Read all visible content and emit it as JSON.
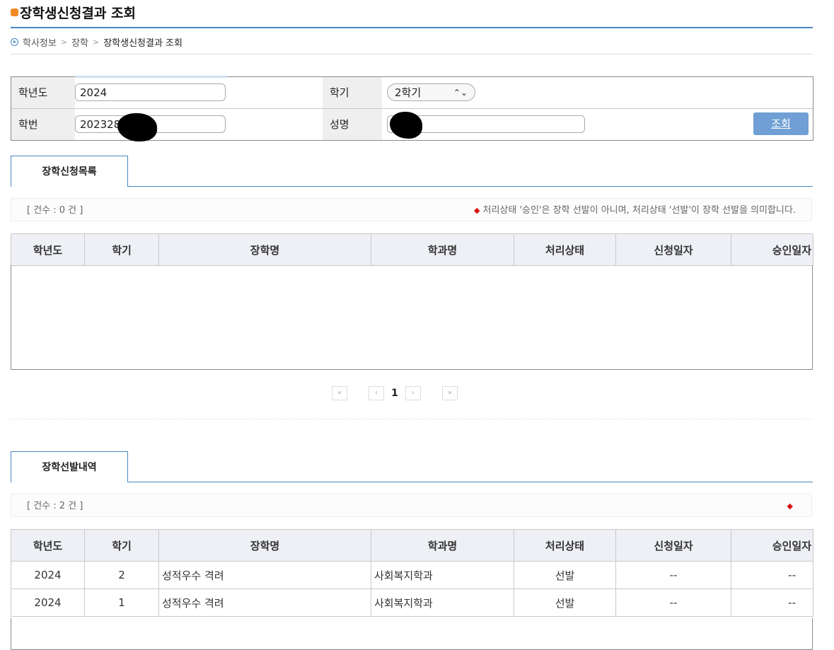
{
  "page": {
    "title": "장학생신청결과 조회"
  },
  "breadcrumb": [
    "학사정보",
    "장학",
    "장학생신청결과 조회"
  ],
  "search": {
    "year_label": "학년도",
    "year_value": "2024",
    "term_label": "학기",
    "term_value": "2학기",
    "student_id_label": "학번",
    "student_id_value": "202328",
    "name_label": "성명",
    "name_value": "",
    "search_button": "조회"
  },
  "applications": {
    "tab_label": "장학신청목록",
    "count_text": "[ 건수 : 0 건 ]",
    "note": "처리상태 '승인'은 장학 선발이 아니며, 처리상태 '선발'이 장학 선발을 의미합니다.",
    "columns": [
      "학년도",
      "학기",
      "장학명",
      "학과명",
      "처리상태",
      "신청일자",
      "승인일자"
    ],
    "rows": []
  },
  "pagination": {
    "first": "«",
    "prev": "‹",
    "current": "1",
    "next": "›",
    "last": "»"
  },
  "selections": {
    "tab_label": "장학선발내역",
    "count_text": "[ 건수 : 2 건 ]",
    "columns": [
      "학년도",
      "학기",
      "장학명",
      "학과명",
      "처리상태",
      "신청일자",
      "승인일자"
    ],
    "rows": [
      [
        "2024",
        "2",
        "성적우수 격려",
        "사회복지학과",
        "선발",
        "--",
        "--"
      ],
      [
        "2024",
        "1",
        "성적우수 격려",
        "사회복지학과",
        "선발",
        "--",
        "--"
      ]
    ]
  }
}
